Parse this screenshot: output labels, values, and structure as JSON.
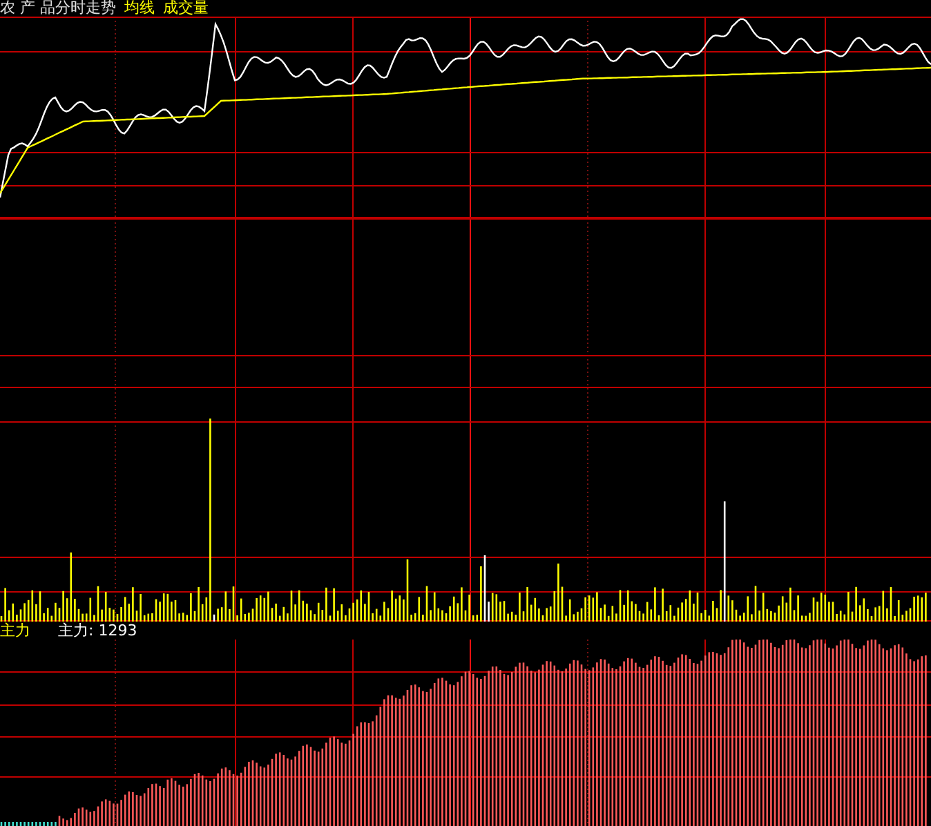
{
  "chart_title": "农 产 品分时走势",
  "legend": [
    {
      "label": "均线",
      "color": "#ffff00"
    },
    {
      "label": "成交量",
      "color": "#ffff00"
    }
  ],
  "indicator": {
    "label": "主力",
    "reading": "主力: 1293"
  }
}
